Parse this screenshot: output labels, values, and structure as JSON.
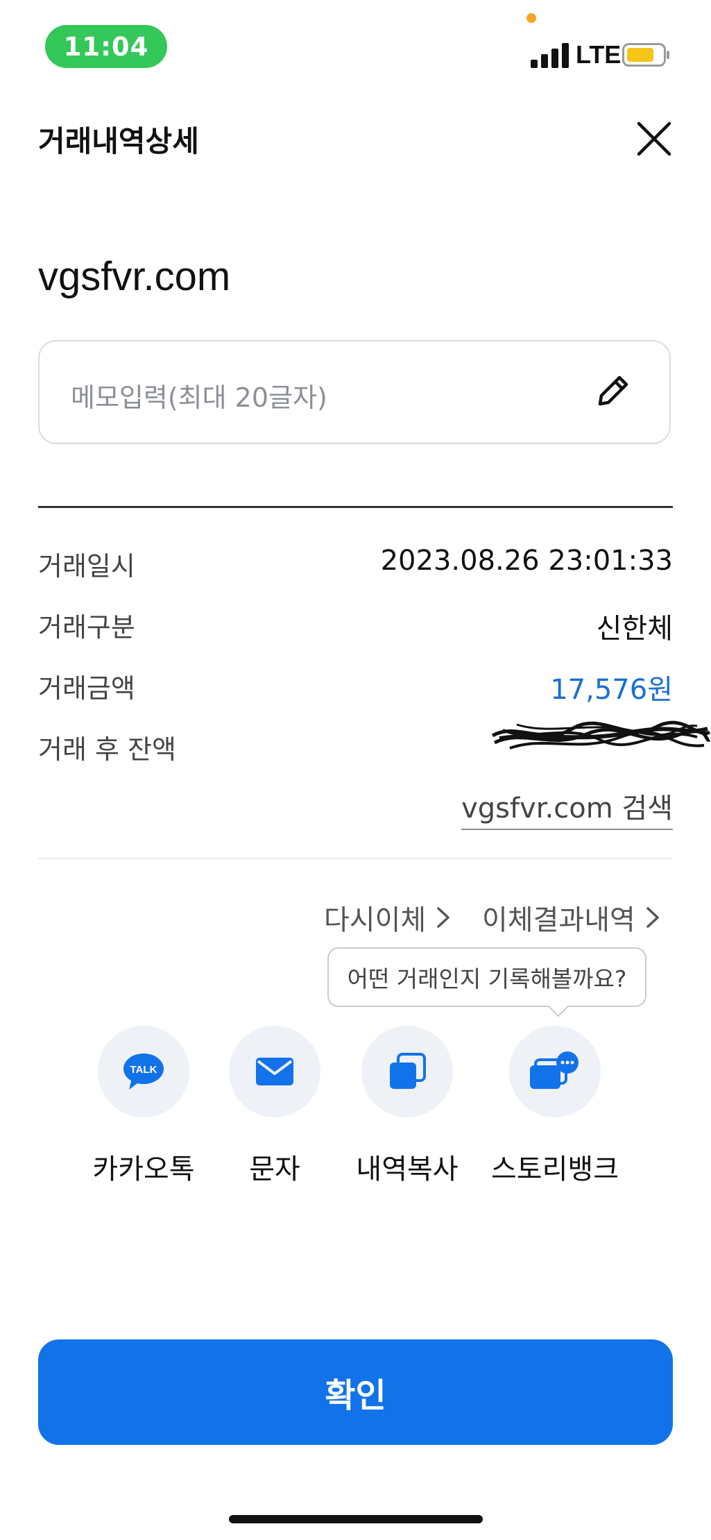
{
  "status_bar": {
    "time": "11:04",
    "network": "LTE"
  },
  "header": {
    "title": "거래내역상세"
  },
  "merchant": "vgsfvr.com",
  "memo": {
    "placeholder": "메모입력(최대 20글자)"
  },
  "details": [
    {
      "label": "거래일시",
      "value": "2023.08.26 23:01:33"
    },
    {
      "label": "거래구분",
      "value": "신한체"
    },
    {
      "label": "거래금액",
      "value": "17,576원"
    },
    {
      "label": "거래 후 잔액",
      "value": ""
    }
  ],
  "search_link": "vgsfvr.com 검색",
  "actions": {
    "retransfer": "다시이체",
    "transfer_result": "이체결과내역"
  },
  "tooltip": "어떤 거래인지 기록해볼까요?",
  "share": [
    {
      "label": "카카오톡",
      "icon": "kakaotalk-icon",
      "badge": "TALK"
    },
    {
      "label": "문자",
      "icon": "mail-icon"
    },
    {
      "label": "내역복사",
      "icon": "copy-icon"
    },
    {
      "label": "스토리뱅크",
      "icon": "storybank-icon"
    }
  ],
  "confirm_label": "확인",
  "colors": {
    "accent": "#1272ea",
    "amount": "#1a6fd6",
    "status_green": "#34c759",
    "battery": "#f5c518"
  }
}
